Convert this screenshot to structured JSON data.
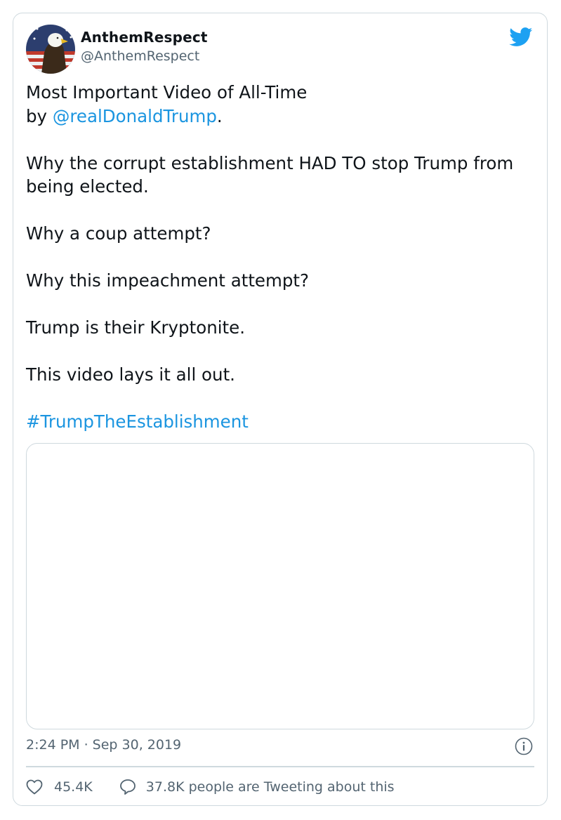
{
  "author": {
    "name": "AnthemRespect",
    "handle": "@AnthemRespect"
  },
  "tweet": {
    "line1": "Most Important Video of All-Time",
    "by_prefix": "by ",
    "mention": "@realDonaldTrump",
    "by_suffix": ".",
    "para2": "Why the corrupt establishment HAD TO stop Trump from being elected.",
    "para3": "Why a coup attempt?",
    "para4": "Why this impeachment attempt?",
    "para5": "Trump is their Kryptonite.",
    "para6": "This video lays it all out.",
    "hashtag": "#TrumpTheEstablishment"
  },
  "timestamp": "2:24 PM · Sep 30, 2019",
  "stats": {
    "likes": "45.4K",
    "tweeting": "37.8K people are Tweeting about this"
  },
  "colors": {
    "link": "#1b95e0",
    "twitter_blue": "#1da1f2",
    "muted_text": "#536471",
    "border": "#cfd9de"
  },
  "icons": [
    "avatar-eagle-flag",
    "twitter-bird-icon",
    "info-icon",
    "heart-icon",
    "reply-bubble-icon"
  ]
}
